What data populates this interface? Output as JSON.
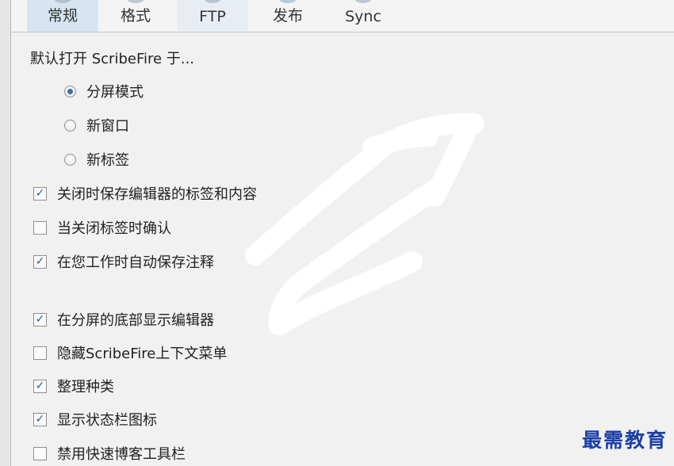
{
  "tabs": [
    {
      "label": "常规",
      "active": true
    },
    {
      "label": "格式",
      "active": false
    },
    {
      "label": "FTP",
      "active": false
    },
    {
      "label": "发布",
      "active": false
    },
    {
      "label": "Sync",
      "active": false
    }
  ],
  "general": {
    "open_heading": "默认打开 ScribeFire 于...",
    "open_options": [
      {
        "label": "分屏模式",
        "selected": true
      },
      {
        "label": "新窗口",
        "selected": false
      },
      {
        "label": "新标签",
        "selected": false
      }
    ],
    "checkboxes": [
      {
        "label": "关闭时保存编辑器的标签和内容",
        "checked": true
      },
      {
        "label": "当关闭标签时确认",
        "checked": false
      },
      {
        "label": "在您工作时自动保存注释",
        "checked": true
      },
      {
        "label": "在分屏的底部显示编辑器",
        "checked": true
      },
      {
        "label": "隐藏ScribeFire上下文菜单",
        "checked": false
      },
      {
        "label": "整理种类",
        "checked": true
      },
      {
        "label": "显示状态栏图标",
        "checked": true
      },
      {
        "label": "禁用快速博客工具栏",
        "checked": false
      }
    ]
  },
  "watermark": "最需教育",
  "colors": {
    "accent": "#3a6ea5",
    "active_tab": "#d7e4f2",
    "watermark": "#1c3fa6"
  }
}
